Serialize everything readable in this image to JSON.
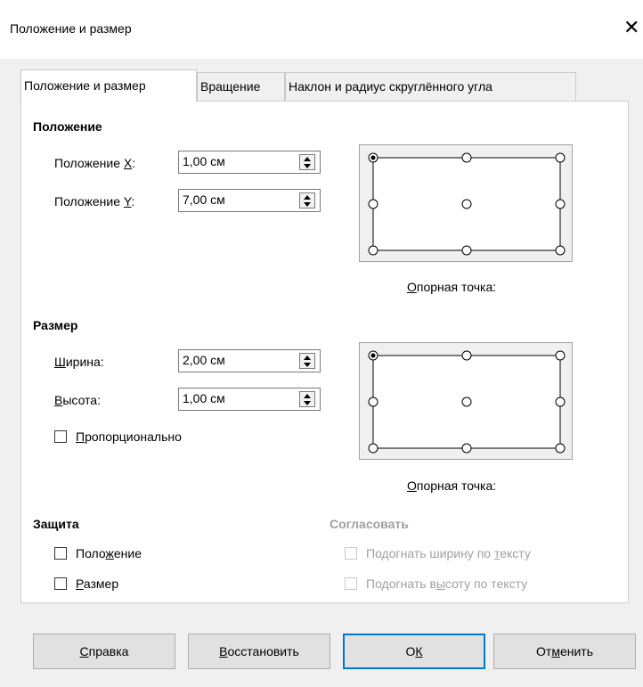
{
  "dialog": {
    "title": "Положение и размер",
    "close_glyph": "✕"
  },
  "tabs": [
    {
      "label": "Положение и размер",
      "active": true
    },
    {
      "label": "Вращение",
      "active": false
    },
    {
      "label": "Наклон и радиус скруглённого угла",
      "active": false
    }
  ],
  "position": {
    "heading": "Положение",
    "x": {
      "label_pre": "Положение ",
      "label_acc": "X",
      "label_post": ":",
      "value": "1,00 см"
    },
    "y": {
      "label_pre": "Положение ",
      "label_acc": "Y",
      "label_post": ":",
      "value": "7,00 см"
    },
    "ref_label_acc": "О",
    "ref_label_rest": "порная точка:",
    "selected_point": "top-left"
  },
  "size": {
    "heading": "Размер",
    "width": {
      "label_acc": "Ш",
      "label_rest": "ирина:",
      "value": "2,00 см"
    },
    "height": {
      "label_acc": "В",
      "label_rest": "ысота:",
      "value": "1,00 см"
    },
    "proportional": {
      "label_acc": "П",
      "label_rest": "ропорционально",
      "checked": false
    },
    "ref_label_acc": "О",
    "ref_label_rest": "порная точка:",
    "selected_point": "top-left"
  },
  "protect": {
    "heading": "Защита",
    "position": {
      "label_pre": "Поло",
      "label_acc": "ж",
      "label_post": "ение",
      "checked": false
    },
    "size": {
      "label_acc": "Р",
      "label_rest": "азмер",
      "checked": false
    }
  },
  "adapt": {
    "heading": "Согласовать",
    "fit_width": {
      "label_pre": "Подогнать ширину по ",
      "label_acc": "т",
      "label_post": "ексту",
      "checked": false,
      "disabled": true
    },
    "fit_height": {
      "label_pre": "Подогнать в",
      "label_acc": "ы",
      "label_post": "соту по тексту",
      "checked": false,
      "disabled": true
    }
  },
  "buttons": {
    "help": {
      "acc": "С",
      "rest": "правка"
    },
    "reset": {
      "acc": "В",
      "rest": "осстановить"
    },
    "ok": {
      "pre": "О",
      "acc": "К"
    },
    "cancel": {
      "pre": "От",
      "acc": "м",
      "post": "енить"
    }
  },
  "colors": {
    "accent": "#0078d7",
    "dialog_bg": "#f0f0f0",
    "panel_bg": "#ffffff"
  }
}
